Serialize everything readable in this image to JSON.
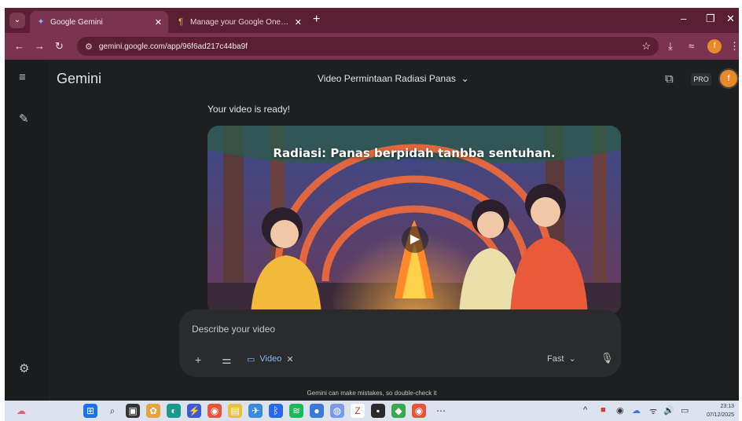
{
  "browser": {
    "tabs": [
      {
        "title": "Google Gemini",
        "active": true
      },
      {
        "title": "Manage your Google One mer",
        "active": false
      }
    ],
    "url": "gemini.google.com/app/96f6ad217c44ba9f",
    "profile_initial": "f"
  },
  "app": {
    "brand": "Gemini",
    "conversation_title": "Video Permintaan Radiasi Panas",
    "pro_label": "PRO",
    "user_initial": "f"
  },
  "response": {
    "text": "Your video is ready!",
    "video_caption": "Radiasi: Panas berpidah tanbba sentuhan."
  },
  "composer": {
    "placeholder": "Describe your video",
    "chip_label": "Video",
    "mode_label": "Fast"
  },
  "disclaimer": "Gemini can make mistakes, so double-check it",
  "taskbar": {
    "time": "23:13",
    "date": "07/12/2025"
  },
  "colors": {
    "tab_strip": "#5a1f33",
    "toolbar": "#7c3350",
    "app_bg": "#1e1f20",
    "accent_orange": "#e98a2a",
    "link_blue": "#8ab4f8"
  }
}
